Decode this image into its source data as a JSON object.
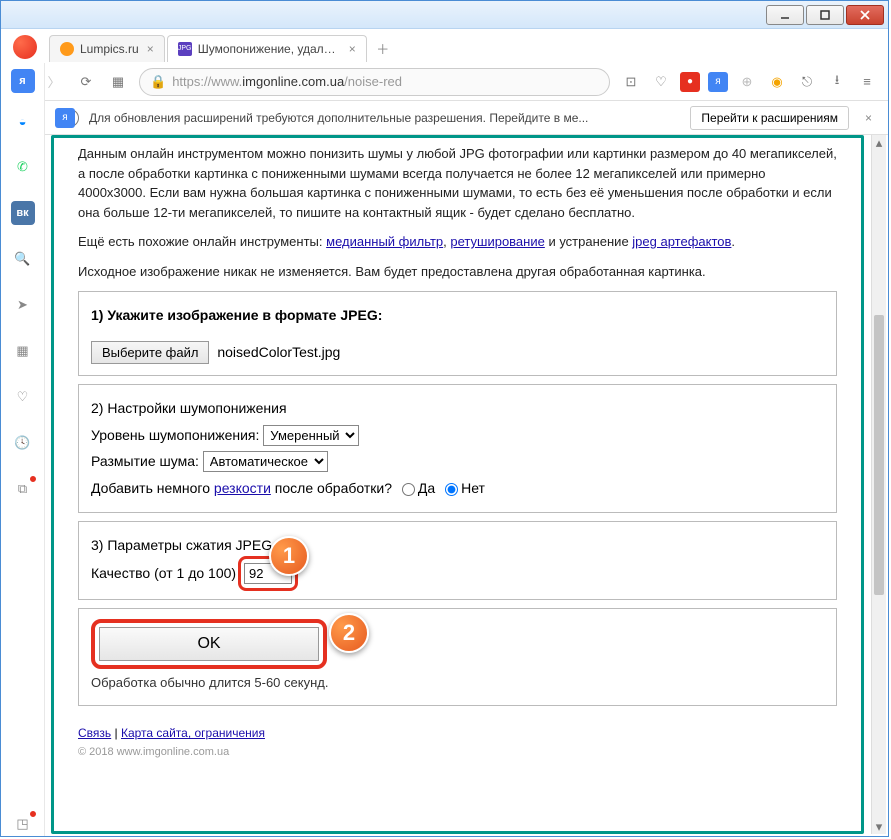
{
  "tabs": [
    {
      "label": "Lumpics.ru",
      "favicon_color": "#ff9a1a"
    },
    {
      "label": "Шумопонижение, удалить",
      "favicon_color": "#5b3fbf"
    }
  ],
  "url": {
    "scheme": "https://",
    "prefix": "www.",
    "domain": "imgonline.com.ua",
    "path": "/noise-red"
  },
  "infobar": {
    "message": "Для обновления расширений требуются дополнительные разрешения. Перейдите в ме...",
    "button": "Перейти к расширениям"
  },
  "intro": {
    "p1_a": "Данным онлайн инструментом можно понизить шумы у любой JPG фотографии или картинки размером до 40 мегапикселей, а после обработки картинка с пониженными шумами всегда получается не более 12 мегапикселей или примерно 4000x3000. Если вам нужна большая картинка с пониженными шумами, то есть без её уменьшения после обработки и если она больше 12-ти мегапикселей, то пишите на контактный ящик - будет сделано бесплатно.",
    "p2_pre": "Ещё есть похожие онлайн инструменты: ",
    "p2_link1": "медианный фильтр",
    "p2_mid": ", ",
    "p2_link2": "ретуширование",
    "p2_mid2": " и устранение ",
    "p2_link3": "jpeg артефактов",
    "p2_end": ".",
    "p3": "Исходное изображение никак не изменяется. Вам будет предоставлена другая обработанная картинка."
  },
  "step1": {
    "title": "1) Укажите изображение в формате JPEG:",
    "file_button": "Выберите файл",
    "file_name": "noisedColorTest.jpg"
  },
  "step2": {
    "title": "2) Настройки шумопонижения",
    "level_label": "Уровень шумопонижения:",
    "level_value": "Умеренный",
    "blur_label": "Размытие шума:",
    "blur_value": "Автоматическое",
    "sharp_pre": "Добавить немного ",
    "sharp_link": "резкости",
    "sharp_post": " после обработки?",
    "yes": "Да",
    "no": "Нет"
  },
  "step3": {
    "title": "3) Параметры сжатия JPEG",
    "quality_label": "Качество (от 1 до 100)",
    "quality_value": "92"
  },
  "submit": {
    "ok": "OK",
    "note": "Обработка обычно длится 5-60 секунд."
  },
  "footer": {
    "link1": "Связь",
    "sep": " | ",
    "link2": "Карта сайта, ограничения",
    "copyright": "© 2018 www.imgonline.com.ua"
  },
  "badges": {
    "one": "1",
    "two": "2"
  }
}
